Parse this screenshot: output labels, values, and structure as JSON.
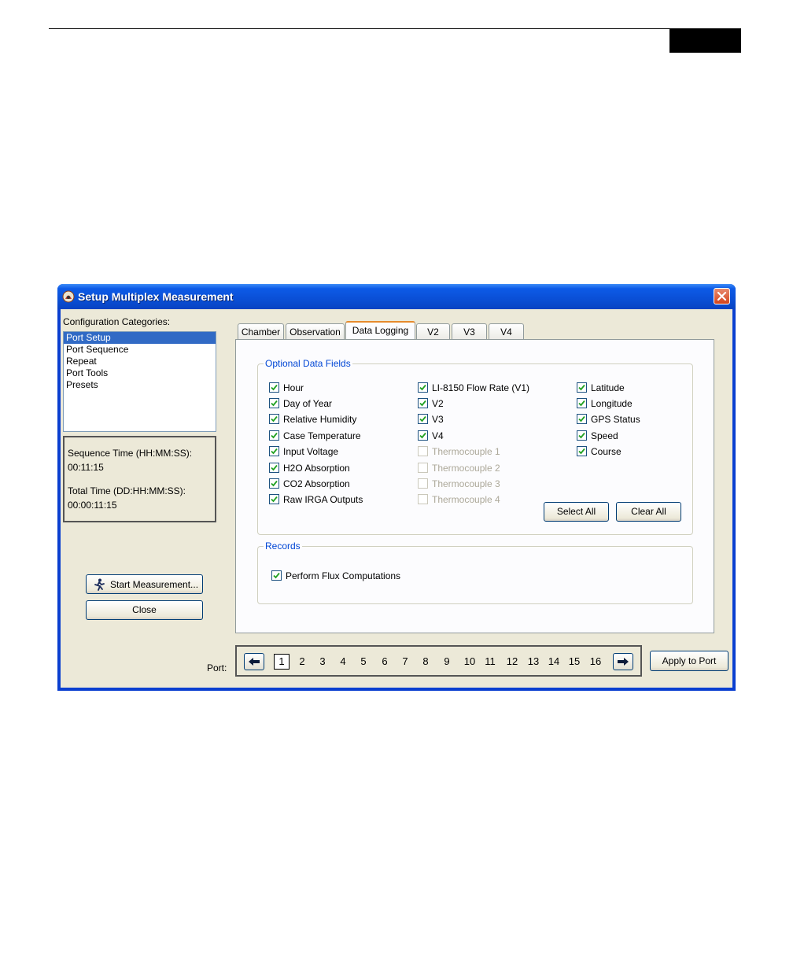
{
  "window": {
    "title": "Setup Multiplex Measurement",
    "icon": "licor-app-icon"
  },
  "sidebar": {
    "categories_label": "Configuration Categories:",
    "categories": [
      {
        "label": "Port Setup",
        "selected": true
      },
      {
        "label": "Port Sequence",
        "selected": false
      },
      {
        "label": "Repeat",
        "selected": false
      },
      {
        "label": "Port Tools",
        "selected": false
      },
      {
        "label": "Presets",
        "selected": false
      }
    ],
    "sequence_time_label": "Sequence Time (HH:MM:SS):",
    "sequence_time_value": "00:11:15",
    "total_time_label": "Total Time (DD:HH:MM:SS):",
    "total_time_value": "00:00:11:15",
    "start_button": "Start Measurement...",
    "close_button": "Close"
  },
  "tabs": [
    {
      "label": "Chamber",
      "active": false
    },
    {
      "label": "Observation",
      "active": false
    },
    {
      "label": "Data Logging",
      "active": true
    },
    {
      "label": "V2",
      "active": false
    },
    {
      "label": "V3",
      "active": false
    },
    {
      "label": "V4",
      "active": false
    }
  ],
  "optional_fields": {
    "title": "Optional Data Fields",
    "columns": [
      [
        {
          "label": "Hour",
          "checked": true,
          "enabled": true
        },
        {
          "label": "Day of Year",
          "checked": true,
          "enabled": true
        },
        {
          "label": "Relative Humidity",
          "checked": true,
          "enabled": true
        },
        {
          "label": "Case Temperature",
          "checked": true,
          "enabled": true
        },
        {
          "label": "Input Voltage",
          "checked": true,
          "enabled": true
        },
        {
          "label": "H2O Absorption",
          "checked": true,
          "enabled": true
        },
        {
          "label": "CO2 Absorption",
          "checked": true,
          "enabled": true
        },
        {
          "label": "Raw IRGA Outputs",
          "checked": true,
          "enabled": true
        }
      ],
      [
        {
          "label": "LI-8150 Flow Rate (V1)",
          "checked": true,
          "enabled": true
        },
        {
          "label": "V2",
          "checked": true,
          "enabled": true
        },
        {
          "label": "V3",
          "checked": true,
          "enabled": true
        },
        {
          "label": "V4",
          "checked": true,
          "enabled": true
        },
        {
          "label": "Thermocouple 1",
          "checked": false,
          "enabled": false
        },
        {
          "label": "Thermocouple 2",
          "checked": false,
          "enabled": false
        },
        {
          "label": "Thermocouple 3",
          "checked": false,
          "enabled": false
        },
        {
          "label": "Thermocouple 4",
          "checked": false,
          "enabled": false
        }
      ],
      [
        {
          "label": "Latitude",
          "checked": true,
          "enabled": true
        },
        {
          "label": "Longitude",
          "checked": true,
          "enabled": true
        },
        {
          "label": "GPS Status",
          "checked": true,
          "enabled": true
        },
        {
          "label": "Speed",
          "checked": true,
          "enabled": true
        },
        {
          "label": "Course",
          "checked": true,
          "enabled": true
        }
      ]
    ],
    "select_all": "Select All",
    "clear_all": "Clear All"
  },
  "records": {
    "title": "Records",
    "flux": {
      "label": "Perform Flux Computations",
      "checked": true
    }
  },
  "port": {
    "label": "Port:",
    "numbers": [
      "1",
      "2",
      "3",
      "4",
      "5",
      "6",
      "7",
      "8",
      "9",
      "10",
      "11",
      "12",
      "13",
      "14",
      "15",
      "16"
    ],
    "selected": "1",
    "apply_button": "Apply to Port"
  },
  "colors": {
    "titlebar": "#0a4fd6",
    "selection": "#316ac5",
    "group_title": "#0046d5",
    "checkmark": "#21a121"
  }
}
